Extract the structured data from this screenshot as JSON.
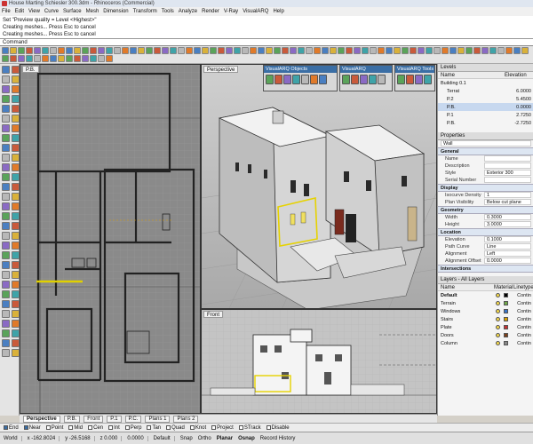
{
  "title": "House Marting Schiesler 300.3dm - Rhinoceros (Commercial)",
  "menu": [
    "File",
    "Edit",
    "View",
    "Curve",
    "Surface",
    "Mesh",
    "Dimension",
    "Transform",
    "Tools",
    "Analyze",
    "Render",
    "V-Ray",
    "VisualARQ",
    "Help"
  ],
  "history": [
    "Set \"Preview quality = Level <Highest>\"",
    "Creating meshes... Press Esc to cancel",
    "Creating meshes... Press Esc to cancel"
  ],
  "command_label": "Command",
  "viewports": {
    "top": "P.B.",
    "perspective": "Perspective",
    "front": "Front"
  },
  "float_toolbars": [
    "VisualARQ Objects",
    "VisualARQ Documentation",
    "VisualARQ Tools"
  ],
  "layers_panel": {
    "title": "Levels",
    "col_name": "Name",
    "col_elev": "Elevation",
    "rows": [
      {
        "name": "Building 0.1",
        "elev": ""
      },
      {
        "name": "Terrat",
        "elev": "6.0000"
      },
      {
        "name": "P.2",
        "elev": "5.4500"
      },
      {
        "name": "P.B.",
        "elev": "0.0000"
      },
      {
        "name": "P.1",
        "elev": "2.7250"
      },
      {
        "name": "P.B.",
        "elev": "-2.7250"
      }
    ]
  },
  "properties_panel": {
    "title": "Properties",
    "type": "Wall",
    "general": {
      "head": "General",
      "rows": [
        {
          "k": "Name",
          "v": ""
        },
        {
          "k": "Description",
          "v": ""
        },
        {
          "k": "Style",
          "v": "Exterior 300"
        },
        {
          "k": "Serial Number",
          "v": ""
        }
      ]
    },
    "display": {
      "head": "Display",
      "rows": [
        {
          "k": "Isocurve Density",
          "v": "1"
        },
        {
          "k": "Plan Visibility",
          "v": "Below cut plane"
        }
      ]
    },
    "geometry": {
      "head": "Geometry",
      "rows": [
        {
          "k": "Width",
          "v": "0.3000"
        },
        {
          "k": "Height",
          "v": "3.0000"
        }
      ]
    },
    "location": {
      "head": "Location",
      "rows": [
        {
          "k": "Elevation",
          "v": "0.1000"
        },
        {
          "k": "Path Curve",
          "v": "Line"
        },
        {
          "k": "Alignment",
          "v": "Left"
        },
        {
          "k": "Alignment Offset",
          "v": "0.0000"
        }
      ]
    },
    "intersections": {
      "head": "Intersections"
    }
  },
  "layers_list": {
    "title": "Layers - All Layers",
    "col_name": "Name",
    "col_mat": "Material",
    "col_line": "Linetype",
    "rows": [
      {
        "name": "Default",
        "mat": "Contin",
        "color": "#000000"
      },
      {
        "name": "Terrain",
        "mat": "Contin",
        "color": "#6fa84a"
      },
      {
        "name": "Windows",
        "mat": "Contin",
        "color": "#3a74c8"
      },
      {
        "name": "Stairs",
        "mat": "Contin",
        "color": "#d9a000"
      },
      {
        "name": "Plate",
        "mat": "Contin",
        "color": "#c43030"
      },
      {
        "name": "Doors",
        "mat": "Contin",
        "color": "#7a3f1a"
      },
      {
        "name": "Column",
        "mat": "Contin",
        "color": "#888888"
      }
    ]
  },
  "bottom_tabs": [
    "Perspective",
    "P.B.",
    "Front",
    "P.1",
    "P.C.",
    "Plans 1",
    "Plans 2"
  ],
  "osnaps": [
    "End",
    "Near",
    "Point",
    "Mid",
    "Cen",
    "Int",
    "Perp",
    "Tan",
    "Quad",
    "Knot",
    "Project",
    "STrack",
    "Disable"
  ],
  "status": {
    "cplane": "World",
    "x": "x -162.8024",
    "y": "y -26.5168",
    "z": "z 0.000",
    "unit": "0.0000",
    "layer": "Default",
    "toggles": [
      "Snap",
      "Ortho",
      "Planar",
      "Osnap",
      "Record History"
    ]
  }
}
